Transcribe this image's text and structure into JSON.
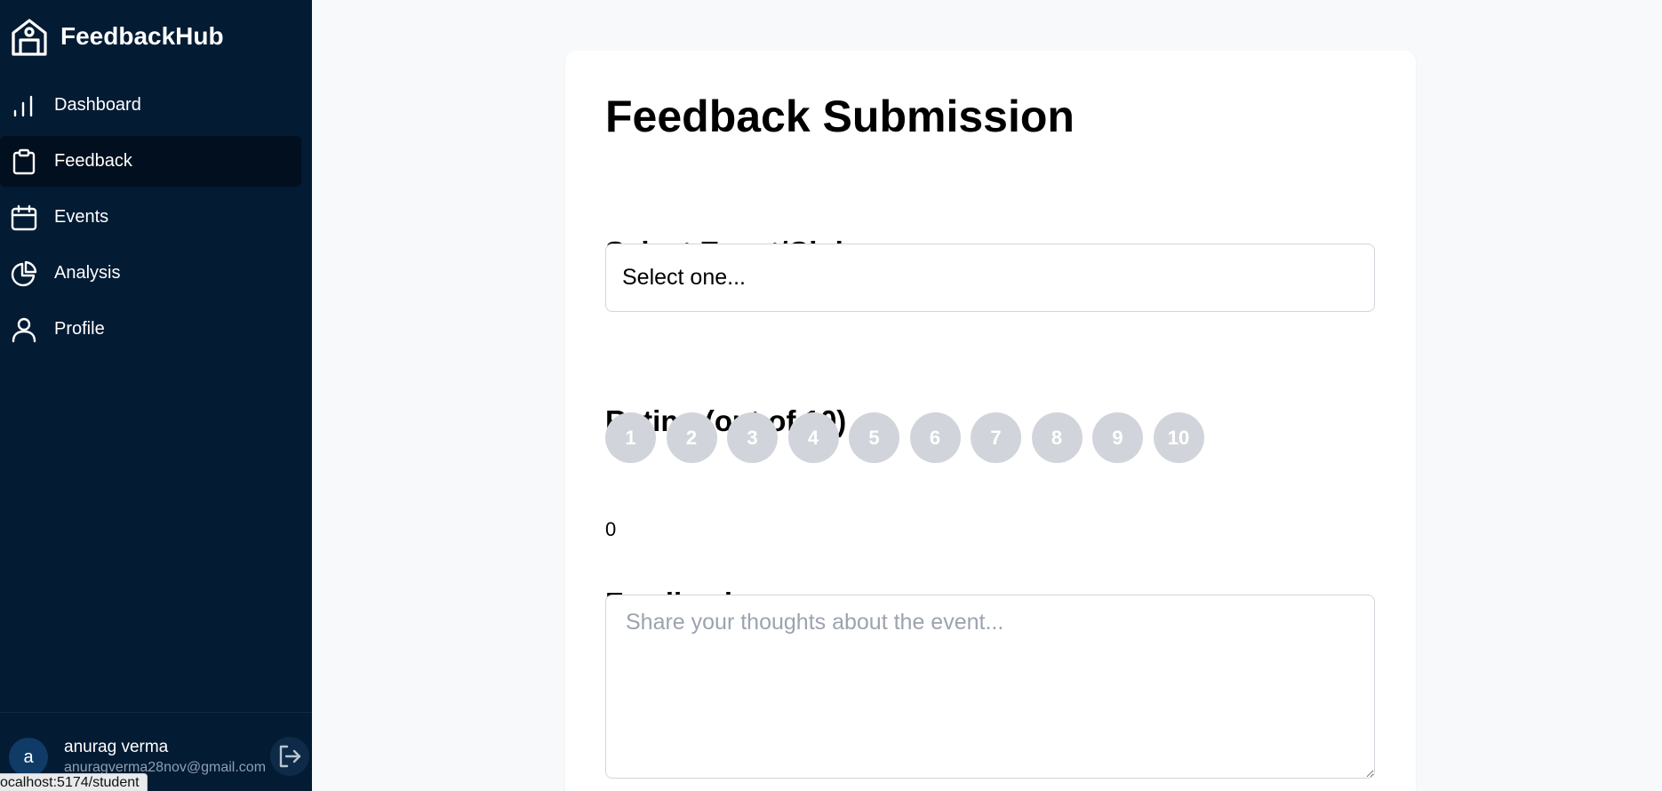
{
  "app": {
    "name": "FeedbackHub"
  },
  "nav": [
    {
      "label": "Dashboard",
      "icon": "bar-chart-icon",
      "active": false
    },
    {
      "label": "Feedback",
      "icon": "clipboard-icon",
      "active": true
    },
    {
      "label": "Events",
      "icon": "calendar-icon",
      "active": false
    },
    {
      "label": "Analysis",
      "icon": "pie-chart-icon",
      "active": false
    },
    {
      "label": "Profile",
      "icon": "user-icon",
      "active": false
    }
  ],
  "user": {
    "initial": "a",
    "name": "anurag verma",
    "email": "anuragverma28nov@gmail.com"
  },
  "status_url": "ocalhost:5174/student",
  "form": {
    "title": "Feedback Submission",
    "select_heading": "Select Event/Club",
    "select_value": "Select one...",
    "rating_heading": "Rating (out of 10)",
    "rating_options": [
      "1",
      "2",
      "3",
      "4",
      "5",
      "6",
      "7",
      "8",
      "9",
      "10"
    ],
    "rating_value": "0",
    "feedback_heading": "Feedback",
    "feedback_placeholder": "Share your thoughts about the event..."
  },
  "colors": {
    "sidebar": "#031b33",
    "active_item": "#020f1e",
    "rating_pill": "#d1d5db",
    "page_bg": "#f8f9fb"
  }
}
